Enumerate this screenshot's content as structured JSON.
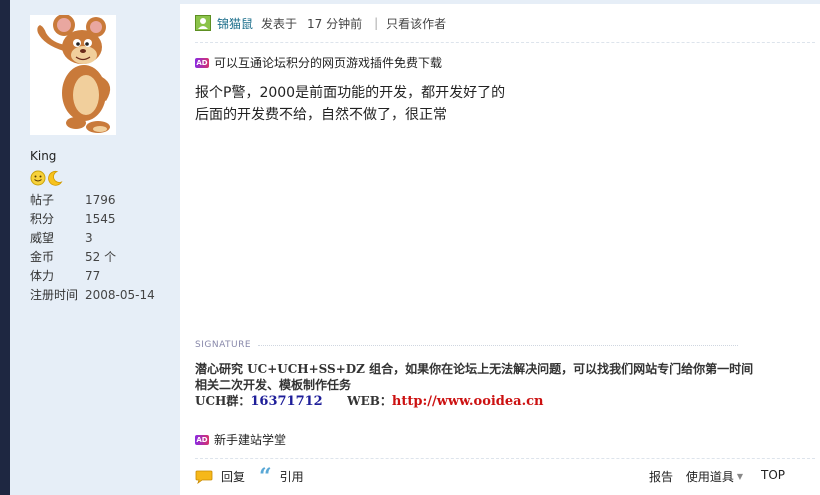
{
  "user": {
    "name": "King",
    "stats": [
      {
        "label": "帖子",
        "value": "1796"
      },
      {
        "label": "积分",
        "value": "1545"
      },
      {
        "label": "威望",
        "value": "3"
      },
      {
        "label": "金币",
        "value": "52 个"
      },
      {
        "label": "体力",
        "value": "77"
      },
      {
        "label": "注册时间",
        "value": "2008-05-14"
      }
    ]
  },
  "post": {
    "author": "锦猫鼠",
    "posted_label": "发表于",
    "time": "17 分钟前",
    "separator": "|",
    "only_author": "只看该作者",
    "ad_top": "可以互通论坛积分的网页游戏插件免费下载",
    "content_lines": [
      "报个P警，2000是前面功能的开发，都开发好了的",
      "后面的开发费不给，自然不做了，很正常"
    ],
    "ad_bottom": "新手建站学堂"
  },
  "signature": {
    "label": "SIGNATURE",
    "line1": "潜心研究 UC+UCH+SS+DZ 组合，如果你在论坛上无法解决问题，可以找我们网站专门给你第一时间",
    "line2": "相关二次开发、模板制作任务",
    "qq_label": "UCH群：",
    "qq_value": "16371712",
    "web_label": "WEB：",
    "web_value": "http://www.ooidea.cn"
  },
  "footer": {
    "reply": "回复",
    "quote": "引用",
    "report": "报告",
    "tools": "使用道具",
    "top": "TOP"
  },
  "colors": {
    "sidebar_bg": "#e6eef7",
    "left_edge": "#1e2741",
    "author_link": "#1a6d8a",
    "signature_link": "#cc1111",
    "signature_qq": "#1e1e99"
  },
  "icons": {
    "avatar": "jerry-mouse-avatar",
    "badges": [
      "smiley-icon",
      "moon-icon"
    ],
    "online": "online-status-icon",
    "ad": "ad-badge-icon",
    "reply": "reply-bubble-icon",
    "quote": "quote-mark-icon",
    "dropdown": "chevron-down-icon"
  }
}
